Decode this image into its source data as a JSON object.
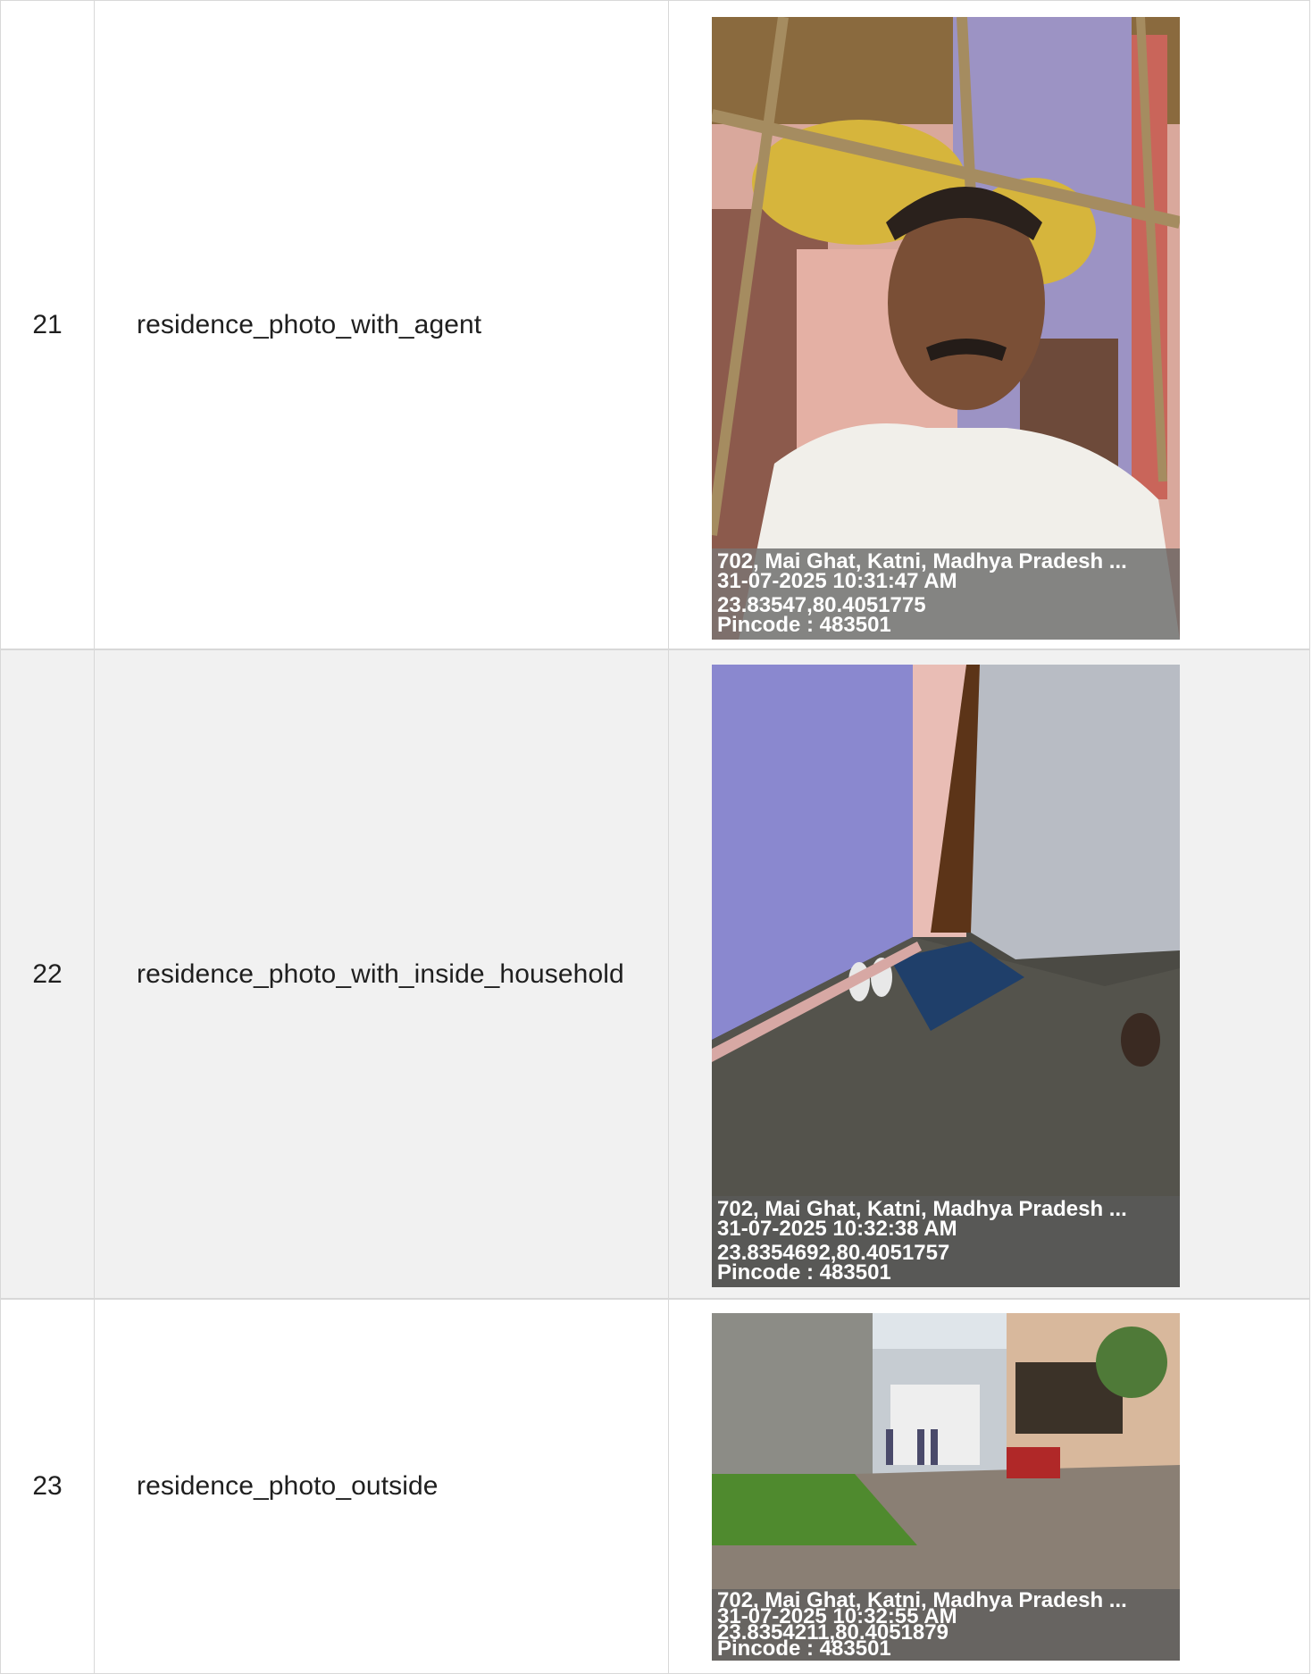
{
  "rows": [
    {
      "number": "21",
      "name": "residence_photo_with_agent",
      "photo": {
        "address": "702, Mai Ghat, Katni, Madhya Pradesh ...",
        "datetime": "31-07-2025 10:31:47 AM",
        "coords": "23.83547,80.4051775",
        "pincode": "Pincode : 483501"
      }
    },
    {
      "number": "22",
      "name": "residence_photo_with_inside_household",
      "photo": {
        "address": "702, Mai Ghat, Katni, Madhya Pradesh ...",
        "datetime": "31-07-2025 10:32:38 AM",
        "coords": "23.8354692,80.4051757",
        "pincode": "Pincode : 483501"
      }
    },
    {
      "number": "23",
      "name": "residence_photo_outside",
      "photo": {
        "address": "702, Mai Ghat, Katni, Madhya Pradesh ...",
        "datetime": "31-07-2025 10:32:55 AM",
        "coords": "23.8354211,80.4051879",
        "pincode": "Pincode : 483501"
      }
    }
  ],
  "colors": {
    "row_alt_bg": "#f1f1f1",
    "border": "#d8d8d8",
    "overlay_bg": "#5a5a5a"
  }
}
